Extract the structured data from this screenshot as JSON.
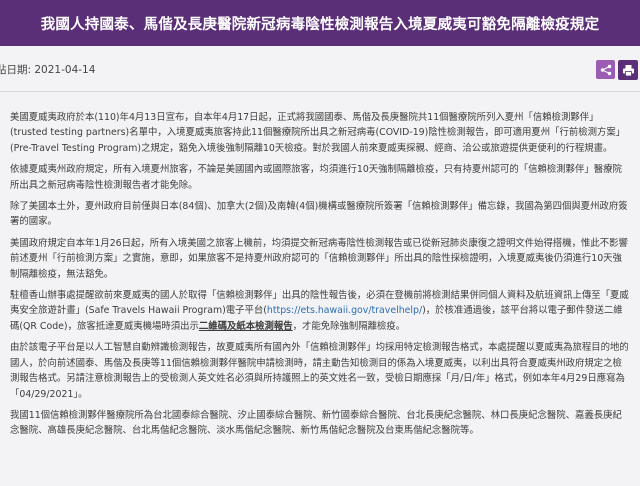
{
  "page": {
    "title": "我國人持國泰、馬偕及長庚醫院新冠病毒陰性檢測報告入境夏威夷可豁免隔離檢疫規定",
    "post_date": "貼日期: 2021-04-14"
  },
  "toolbar": {
    "share_icon": "share-icon",
    "print_icon": "printer-icon",
    "accent_color": "#5b2f78",
    "share_color": "#9b5cb4"
  },
  "content": {
    "p1": "美國夏威夷政府於本(110)年4月13日宣布，自本年4月17日起，正式將我國國泰、馬偕及長庚醫院共11個醫療院所列入夏州「信賴檢測夥伴」(trusted testing partners)名單中，入境夏威夷旅客持此11個醫療院所出具之新冠病毒(COVID-19)陰性檢測報告，即可適用夏州「行前檢測方案」(Pre-Travel Testing Program)之規定，豁免入境後強制隔離10天檢疫。對於我國人前來夏威夷探親、經商、洽公或旅遊提供更便利的行程規畫。",
    "p2": "依據夏威夷州政府規定，所有入境夏州旅客，不論是美國國內或國際旅客，均須進行10天強制隔離檢疫，只有持夏州認可的「信賴檢測夥伴」醫療院所出具之新冠病毒陰性檢測報告者才能免除。",
    "p3": "除了美國本土外，夏州政府目前僅與日本(84個)、加拿大(2個)及南韓(4個)機構或醫療院所簽署「信賴檢測夥伴」備忘錄，我國為第四個與夏州政府簽署的國家。",
    "p4": "美國政府規定自本年1月26日起，所有入境美國之旅客上機前，均須提交新冠病毒陰性檢測報告或已從新冠肺炎康復之證明文件始得搭機，惟此不影響前述夏州「行前檢測方案」之實施，意即，如果旅客不是持夏州政府認可的「信賴檢測夥伴」所出具的陰性採檢證明，入境夏威夷後仍須進行10天強制隔離檢疫，無法豁免。",
    "p5_a": "駐檀香山辦事處提醒欲前來夏威夷的國人於取得「信賴檢測夥伴」出具的陰性報告後，必須在登機前將檢測結果併同個人資料及航班資訊上傳至「夏威夷安全旅遊計畫」(Safe Travels Hawaii Program)電子平台(",
    "p5_link": "https://ets.hawaii.gov/travelhelp/",
    "p5_b": ")，於核准通過後，該平台將以電子郵件發送二維碼(QR Code)，旅客抵達夏威夷機場時須出示",
    "p5_under": "二維碼及紙本檢測報告",
    "p5_c": "，才能免除強制隔離檢疫。",
    "p6": "由於該電子平台是以人工智慧自動辨識檢測報告，故夏威夷所有國內外「信賴檢測夥伴」均採用特定檢測報告格式，本處提醒以夏威夷為旅程目的地的國人，於向前述國泰、馬偕及長庚等11個信賴檢測夥伴醫院申請檢測時，請主動告知檢測目的係為入境夏威夷，以利出具符合夏威夷州政府規定之檢測報告格式。另請注意檢測報告上的受檢測人英文姓名必須與所持護照上的英文姓名一致，受檢日期應採「月/日/年」格式，例如本年4月29日應寫為「04/29/2021」。",
    "p7": "我國11個信賴檢測夥伴醫療院所為台北國泰綜合醫院、汐止國泰綜合醫院、新竹國泰綜合醫院、台北長庚紀念醫院、林口長庚紀念醫院、嘉義長庚紀念醫院、高雄長庚紀念醫院、台北馬偕紀念醫院、淡水馬偕紀念醫院、新竹馬偕紀念醫院及台東馬偕紀念醫院等。"
  }
}
